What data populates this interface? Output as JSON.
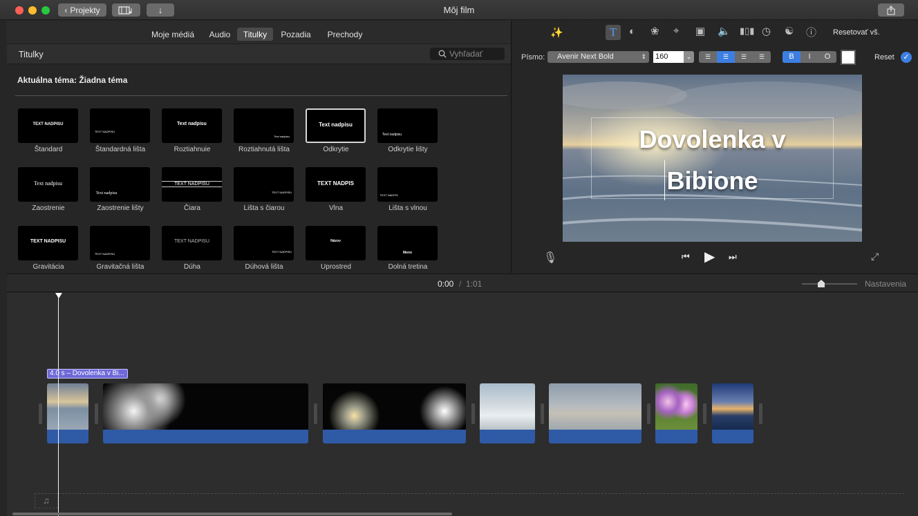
{
  "window": {
    "title": "Môj film"
  },
  "toolbar": {
    "projects_label": "Projekty"
  },
  "tabs": [
    {
      "label": "Moje médiá"
    },
    {
      "label": "Audio"
    },
    {
      "label": "Titulky"
    },
    {
      "label": "Pozadia"
    },
    {
      "label": "Prechody"
    }
  ],
  "browser": {
    "section_title": "Titulky",
    "search_placeholder": "Vyhľadať",
    "theme_label": "Aktuálna téma: Žiadna téma",
    "titles": [
      {
        "label": "Štandard",
        "preview": "TEXT NADPISU"
      },
      {
        "label": "Štandardná lišta",
        "preview": "TEXT NADPISU"
      },
      {
        "label": "Roztiahnuie",
        "preview": "Text nadpisu"
      },
      {
        "label": "Roztiahnutá lišta",
        "preview": "Text nadpisu"
      },
      {
        "label": "Odkrytie",
        "preview": "Text nadpisu"
      },
      {
        "label": "Odkrytie lišty",
        "preview": "Text nadpisu"
      },
      {
        "label": "Zaostrenie",
        "preview": "Text nadpisu"
      },
      {
        "label": "Zaostrenie lišty",
        "preview": "Text nadpisu"
      },
      {
        "label": "Čiara",
        "preview": "TEXT NADPISU"
      },
      {
        "label": "Lišta s čiarou",
        "preview": "TEXT NADPISU"
      },
      {
        "label": "Vlna",
        "preview": "TEXT NADPIS"
      },
      {
        "label": "Lišta s vlnou",
        "preview": "TEXT NADPIS"
      },
      {
        "label": "Gravitácia",
        "preview": "TEXT NADPISU"
      },
      {
        "label": "Gravitačná lišta",
        "preview": "TEXT NADPISU"
      },
      {
        "label": "Dúha",
        "preview": "TEXT NADPISU"
      },
      {
        "label": "Dúhová lišta",
        "preview": "TEXT NADPISU"
      },
      {
        "label": "Uprostred",
        "preview": "Názov"
      },
      {
        "label": "Dolná tretina",
        "preview": "Meno"
      }
    ]
  },
  "inspector": {
    "reset_all_label": "Resetovať vš.",
    "font_label": "Písmo:",
    "font_value": "Avenir Next Bold",
    "size_value": "160",
    "style_buttons": [
      "B",
      "I",
      "O"
    ],
    "reset_label": "Reset",
    "text_color": "#ffffff"
  },
  "viewer": {
    "title_line1": "Dovolenka v",
    "title_line2": "Bibione"
  },
  "timeline": {
    "current_time": "0:00",
    "separator": "/",
    "duration": "1:01",
    "settings_label": "Nastavenia",
    "title_clip_label": "4.0 s – Dovolenka v Bi..."
  },
  "colors": {
    "accent": "#3d7fe0",
    "audio": "#2f5aa6",
    "title_clip": "#6e68d8"
  }
}
